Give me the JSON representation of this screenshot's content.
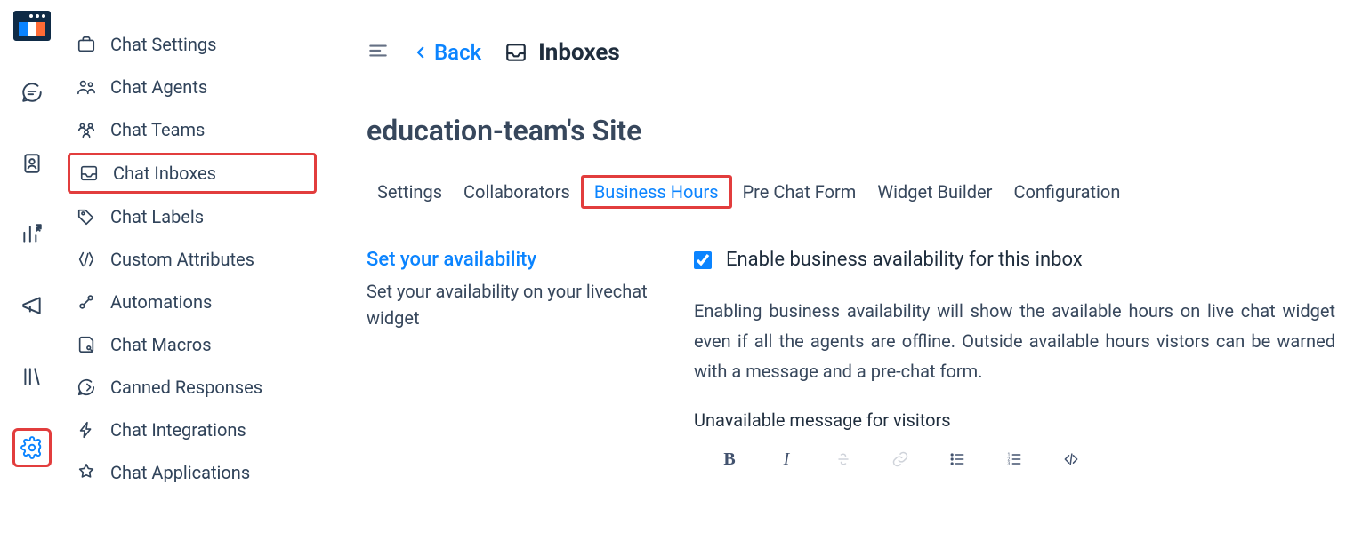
{
  "rail": [
    {
      "key": "logo"
    },
    {
      "key": "chat-icon"
    },
    {
      "key": "contacts-icon"
    },
    {
      "key": "reports-icon"
    },
    {
      "key": "campaigns-icon"
    },
    {
      "key": "library-icon"
    },
    {
      "key": "settings-icon",
      "active": true,
      "highlight": true
    }
  ],
  "secondary": [
    {
      "key": "chat-settings",
      "label": "Chat Settings"
    },
    {
      "key": "chat-agents",
      "label": "Chat Agents"
    },
    {
      "key": "chat-teams",
      "label": "Chat Teams"
    },
    {
      "key": "chat-inboxes",
      "label": "Chat Inboxes",
      "highlight": true
    },
    {
      "key": "chat-labels",
      "label": "Chat Labels"
    },
    {
      "key": "custom-attributes",
      "label": "Custom Attributes"
    },
    {
      "key": "automations",
      "label": "Automations"
    },
    {
      "key": "chat-macros",
      "label": "Chat Macros"
    },
    {
      "key": "canned-responses",
      "label": "Canned Responses"
    },
    {
      "key": "chat-integrations",
      "label": "Chat Integrations"
    },
    {
      "key": "chat-applications",
      "label": "Chat Applications"
    }
  ],
  "topbar": {
    "back_label": "Back",
    "title": "Inboxes"
  },
  "page_title": "education-team's Site",
  "tabs": [
    {
      "key": "settings",
      "label": "Settings"
    },
    {
      "key": "collaborators",
      "label": "Collaborators"
    },
    {
      "key": "business-hours",
      "label": "Business Hours",
      "active": true,
      "highlight": true
    },
    {
      "key": "pre-chat-form",
      "label": "Pre Chat Form"
    },
    {
      "key": "widget-builder",
      "label": "Widget Builder"
    },
    {
      "key": "configuration",
      "label": "Configuration"
    }
  ],
  "availability": {
    "heading": "Set your availability",
    "sub": "Set your availability on your livechat widget",
    "checkbox_label": "Enable business availability for this inbox",
    "checkbox_checked": true,
    "desc": "Enabling business availability will show the available hours on live chat widget even if all the agents are offline. Outside available hours vistors can be warned with a message and a pre-chat form.",
    "field_label": "Unavailable message for visitors"
  },
  "editor_buttons": [
    "bold",
    "italic",
    "strike",
    "link",
    "ul",
    "ol",
    "code"
  ]
}
